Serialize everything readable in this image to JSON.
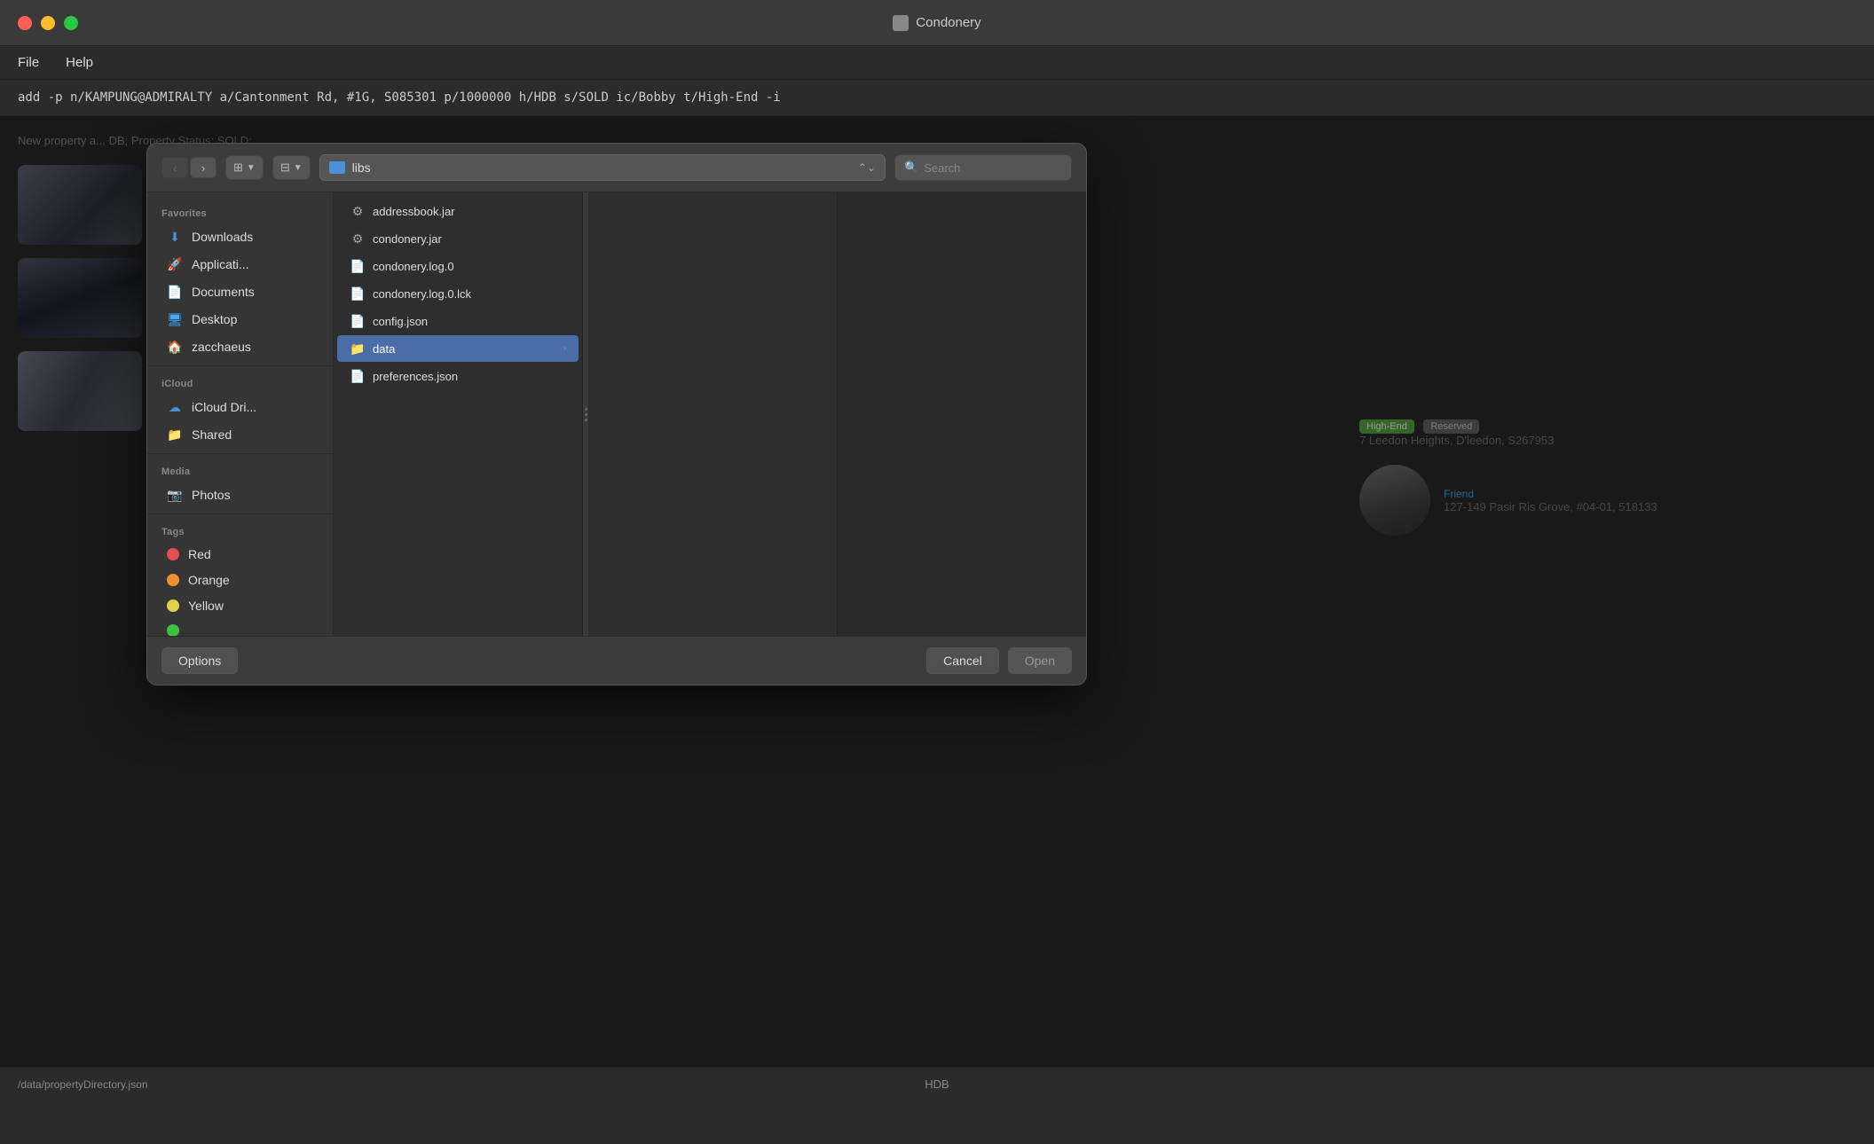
{
  "app": {
    "title": "Condonery",
    "titlebar_icon": "📋"
  },
  "traffic_lights": {
    "close": "close",
    "minimize": "minimize",
    "maximize": "maximize"
  },
  "menubar": {
    "items": [
      "File",
      "Help"
    ]
  },
  "commandbar": {
    "text": "add -p n/KAMPUNG@ADMIRALTY a/Cantonment Rd, #1G, S085301 p/1000000 h/HDB s/SOLD ic/Bobby t/High-End  -i"
  },
  "bg_content": {
    "header": "New property a...                                                                                           DB; Property\nStatus: SOLD;",
    "right_tag1": "High-End",
    "right_tag2": "Reserved",
    "right_address1": "7 Leedon Heights, D'leedon, S267953",
    "right_tag3": "Friend",
    "right_address2": "127-149 Pasir Ris Grove, #04-01, 518133"
  },
  "statusbar": {
    "left": "/data/propertyDirectory.json",
    "center": "HDB"
  },
  "dialog": {
    "nav": {
      "back_label": "‹",
      "forward_label": "›"
    },
    "view_btn1_label": "⊞",
    "view_btn2_label": "⊟",
    "location": {
      "text": "libs",
      "icon": "folder"
    },
    "search": {
      "placeholder": "Search",
      "icon": "🔍"
    },
    "sidebar": {
      "sections": [
        {
          "label": "Favorites",
          "items": [
            {
              "id": "downloads",
              "label": "Downloads",
              "icon": "⬇",
              "icon_color": "#4a90d9"
            },
            {
              "id": "applications",
              "label": "Applicati...",
              "icon": "🚀",
              "icon_color": "#e05"
            },
            {
              "id": "documents",
              "label": "Documents",
              "icon": "📄",
              "icon_color": "#fff"
            },
            {
              "id": "desktop",
              "label": "Desktop",
              "icon": "🖥",
              "icon_color": "#4af"
            },
            {
              "id": "zacchaeus",
              "label": "zacchaeus",
              "icon": "🏠",
              "icon_color": "#4a9"
            }
          ]
        },
        {
          "label": "iCloud",
          "items": [
            {
              "id": "icloud-drive",
              "label": "iCloud Dri...",
              "icon": "☁",
              "icon_color": "#4a90d9"
            },
            {
              "id": "shared",
              "label": "Shared",
              "icon": "📁",
              "icon_color": "#aaa"
            }
          ]
        },
        {
          "label": "Media",
          "items": [
            {
              "id": "photos",
              "label": "Photos",
              "icon": "📷",
              "icon_color": "#aaa"
            }
          ]
        },
        {
          "label": "Tags",
          "items": [
            {
              "id": "red",
              "label": "Red",
              "color": "#e05050"
            },
            {
              "id": "orange",
              "label": "Orange",
              "color": "#f09030"
            },
            {
              "id": "yellow",
              "label": "Yellow",
              "color": "#e0d050"
            }
          ]
        }
      ]
    },
    "files": {
      "pane1": [
        {
          "id": "addressbook",
          "name": "addressbook.jar",
          "icon": "⚙",
          "type": "jar"
        },
        {
          "id": "condonery",
          "name": "condonery.jar",
          "icon": "⚙",
          "type": "jar"
        },
        {
          "id": "log0",
          "name": "condonery.log.0",
          "icon": "📄",
          "type": "log"
        },
        {
          "id": "log0lck",
          "name": "condonery.log.0.lck",
          "icon": "📄",
          "type": "lck"
        },
        {
          "id": "config",
          "name": "config.json",
          "icon": "📄",
          "type": "json"
        },
        {
          "id": "data",
          "name": "data",
          "icon": "📁",
          "type": "folder",
          "selected": true,
          "has_children": true
        },
        {
          "id": "preferences",
          "name": "preferences.json",
          "icon": "📄",
          "type": "json"
        }
      ]
    },
    "footer": {
      "options_label": "Options",
      "cancel_label": "Cancel",
      "open_label": "Open"
    }
  }
}
